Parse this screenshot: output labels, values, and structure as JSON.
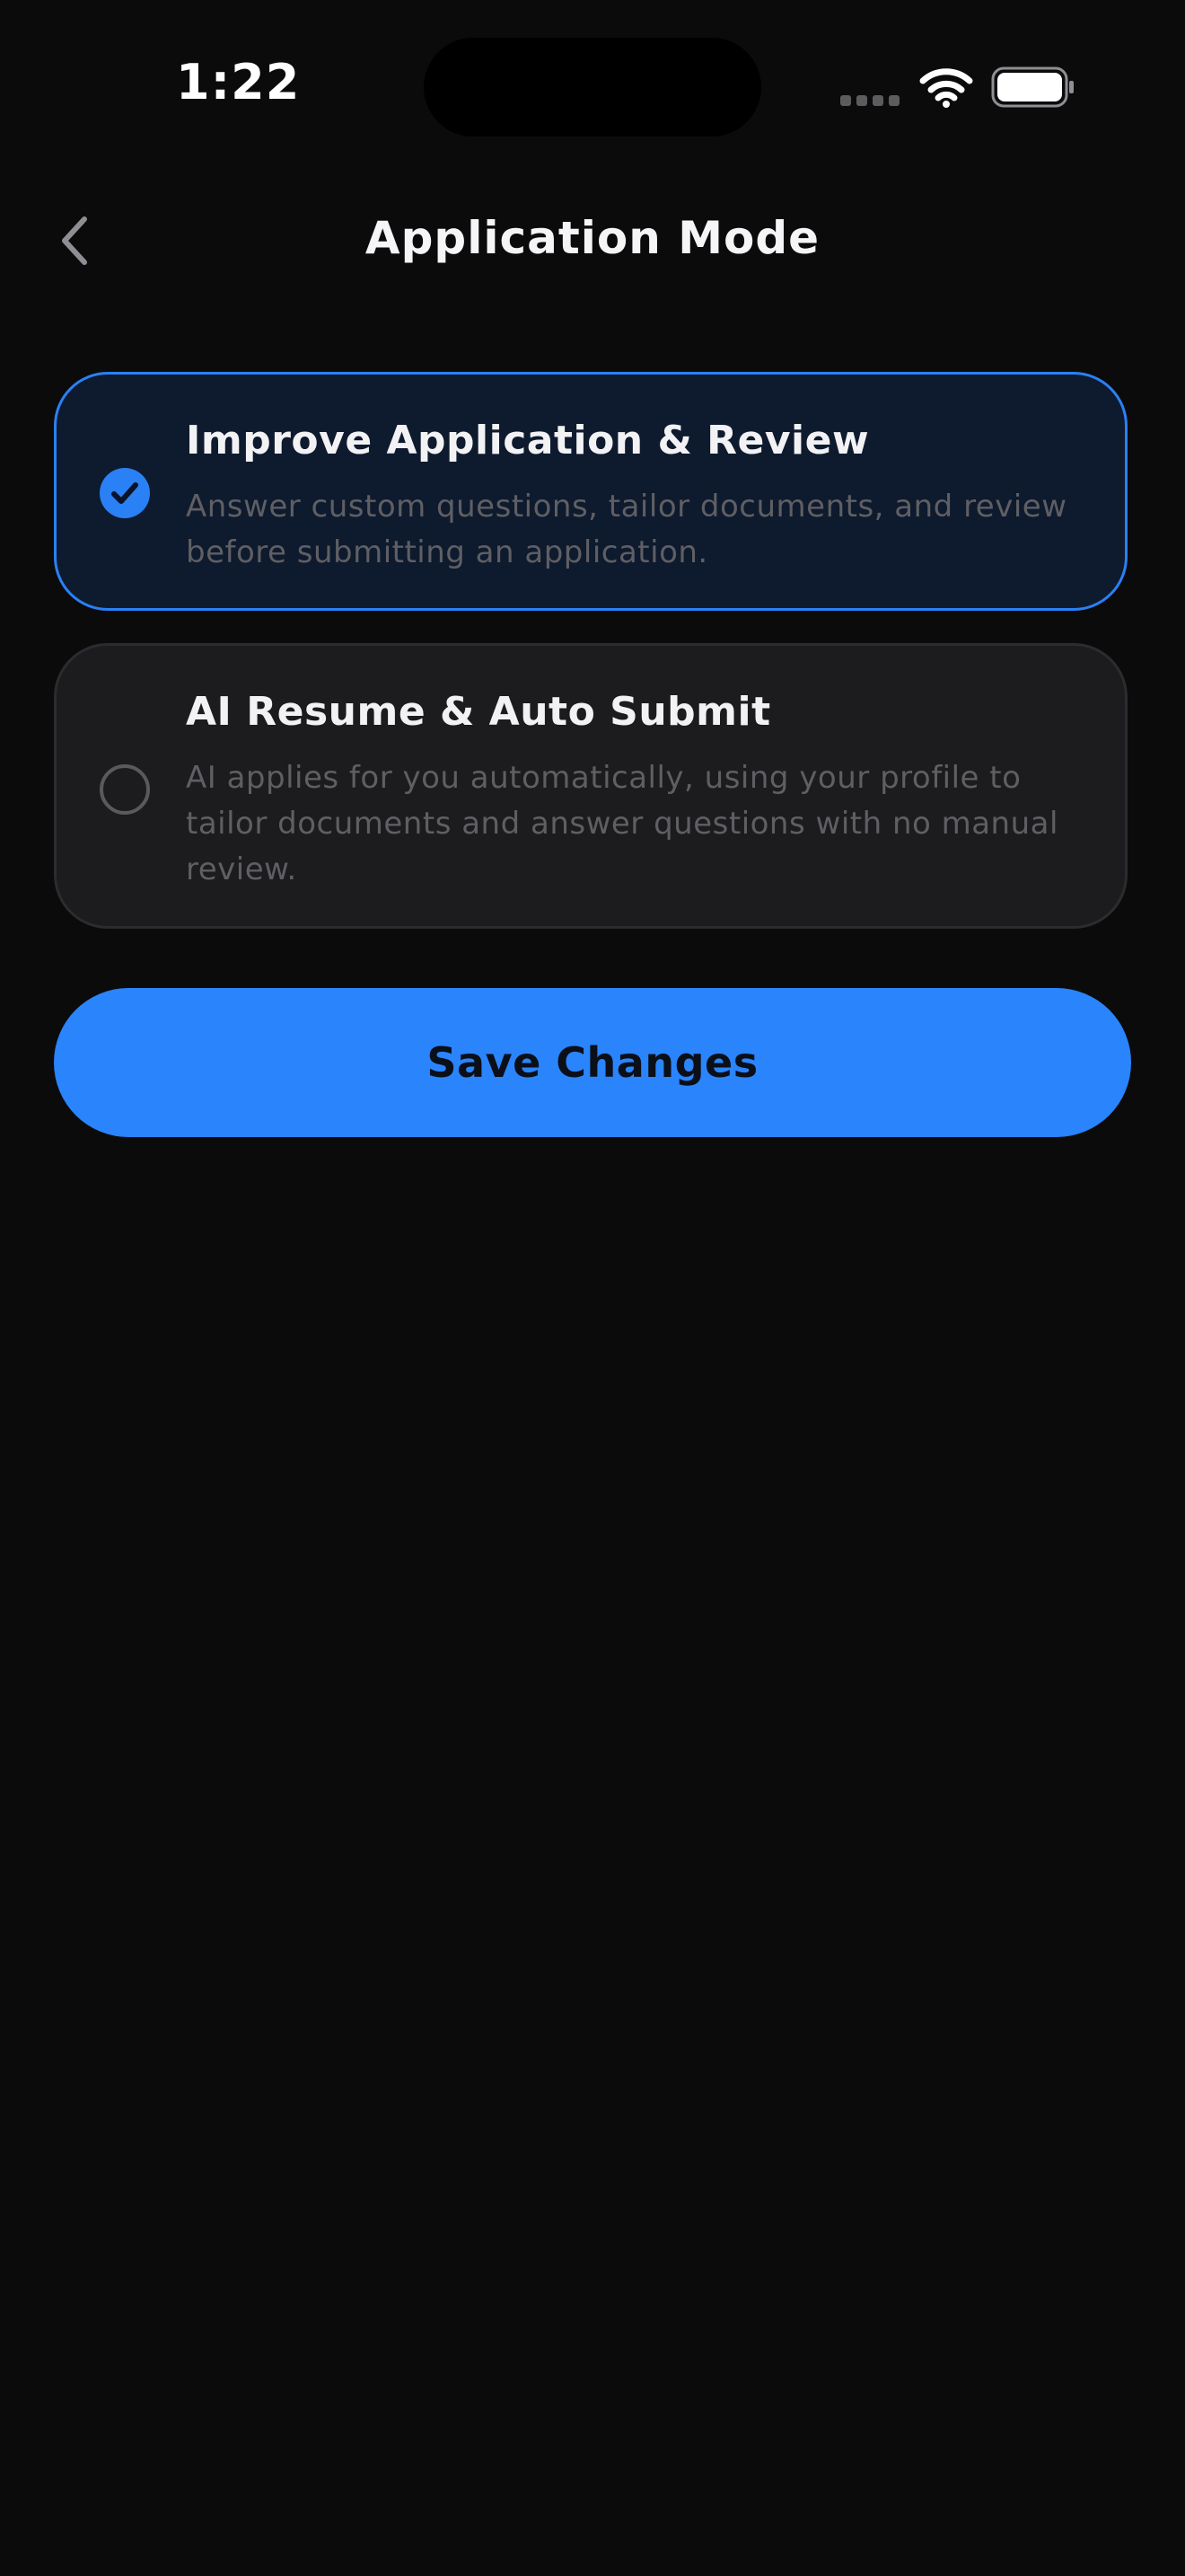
{
  "status_bar": {
    "time": "1:22",
    "icons": [
      "signal-icon",
      "wifi-icon",
      "battery-icon"
    ]
  },
  "header": {
    "title": "Application Mode",
    "back_icon": "chevron-left-icon"
  },
  "options": [
    {
      "title": "Improve Application & Review",
      "description": "Answer custom questions, tailor documents, and review before submitting an application.",
      "selected": true,
      "icon": "check-circle-icon"
    },
    {
      "title": "AI Resume & Auto Submit",
      "description": "AI applies for you automatically, using your profile to tailor documents and answer questions with no manual review.",
      "selected": false,
      "icon": "empty-radio-icon"
    }
  ],
  "save_button": {
    "label": "Save Changes"
  },
  "colors": {
    "background": "#0b0b0c",
    "accent": "#2a84fc",
    "selected_card_bg": "#0e1a2e",
    "card_bg": "#1c1c1e",
    "description_text": "#5f5f63"
  }
}
